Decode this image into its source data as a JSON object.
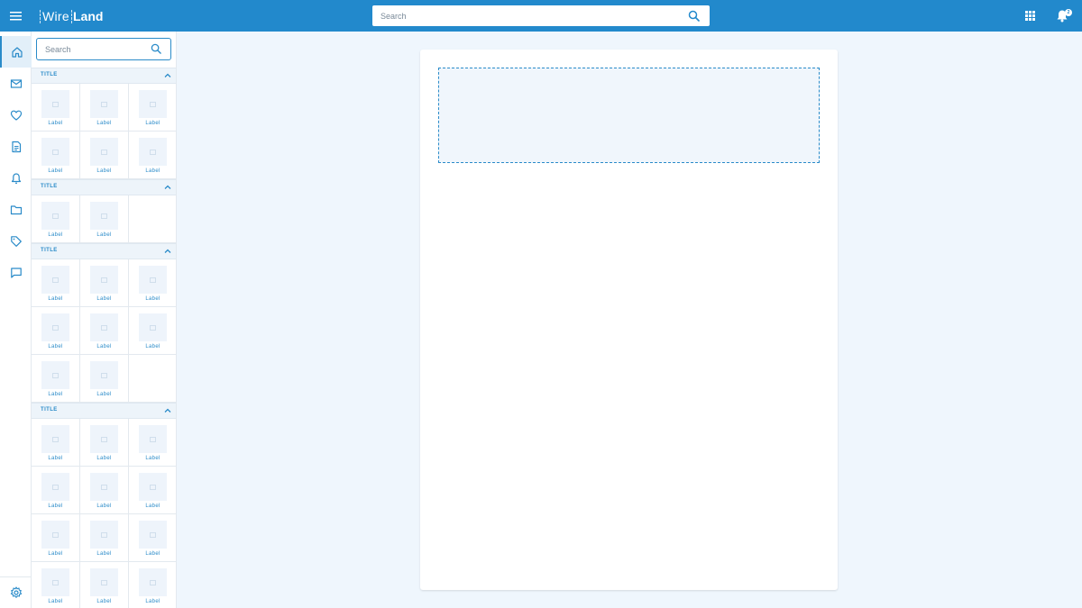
{
  "app": {
    "logo_part1": "Wire",
    "logo_part2": "Land",
    "notification_count": "2"
  },
  "top_search": {
    "placeholder": "Search"
  },
  "panel_search": {
    "placeholder": "Search"
  },
  "rail": {
    "items": [
      "home-icon",
      "mail-icon",
      "heart-icon",
      "document-icon",
      "bell-icon",
      "folder-icon",
      "tag-icon",
      "chat-icon"
    ],
    "active": "home-icon",
    "settings": "gear-icon"
  },
  "sections": [
    {
      "title": "TITLE",
      "items": [
        "Label",
        "Label",
        "Label",
        "Label",
        "Label",
        "Label"
      ]
    },
    {
      "title": "TITLE",
      "items": [
        "Label",
        "Label"
      ]
    },
    {
      "title": "TITLE",
      "items": [
        "Label",
        "Label",
        "Label",
        "Label",
        "Label",
        "Label",
        "Label",
        "Label"
      ]
    },
    {
      "title": "TITLE",
      "items": [
        "Label",
        "Label",
        "Label",
        "Label",
        "Label",
        "Label",
        "Label",
        "Label",
        "Label",
        "Label",
        "Label",
        "Label"
      ]
    }
  ],
  "colors": {
    "brand": "#2289cc",
    "accent": "#2a8bc9",
    "background": "#eff6fd"
  }
}
